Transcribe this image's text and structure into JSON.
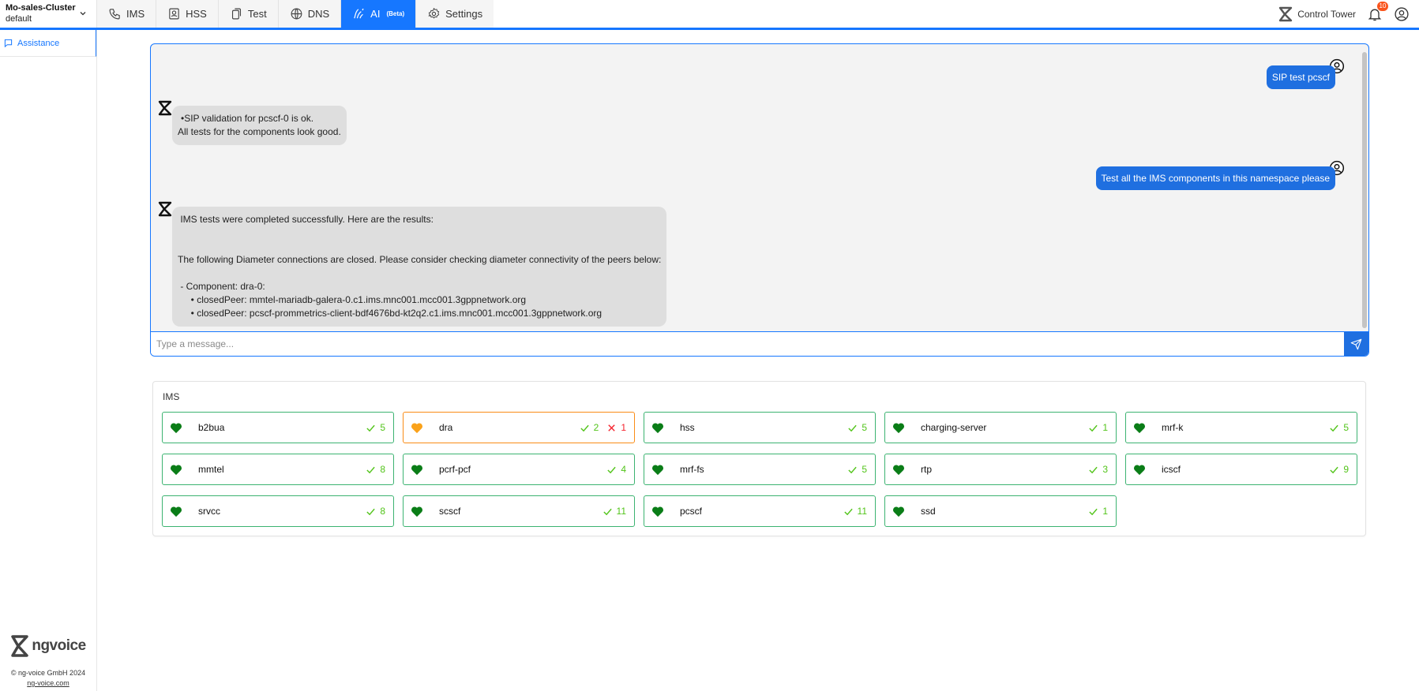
{
  "cluster": {
    "name": "Mo-sales-Cluster",
    "namespace": "default"
  },
  "tabs": [
    {
      "label": "IMS",
      "icon": "phone-icon"
    },
    {
      "label": "HSS",
      "icon": "contact-icon"
    },
    {
      "label": "Test",
      "icon": "test-icon"
    },
    {
      "label": "DNS",
      "icon": "globe-icon"
    },
    {
      "label": "AI",
      "badge": "(Beta)",
      "icon": "ai-icon"
    },
    {
      "label": "Settings",
      "icon": "gear-icon"
    }
  ],
  "header": {
    "control_tower": "Control Tower",
    "notifications": "10"
  },
  "sidebar": {
    "items": [
      {
        "label": "Assistance"
      }
    ]
  },
  "footer": {
    "copyright": "© ng-voice GmbH 2024",
    "site": "ng-voice.com",
    "logo_text": "ngvoice"
  },
  "chat": {
    "messages": [
      {
        "role": "user",
        "text": "SIP test pcscf"
      },
      {
        "role": "bot",
        "lines": [
          "•SIP validation for pcscf-0 is ok.",
          "All tests for the components look good."
        ]
      },
      {
        "role": "user",
        "text": "Test all the IMS components in this namespace please"
      },
      {
        "role": "bot",
        "lines": [
          " IMS tests were completed successfully. Here are the results:",
          "",
          "",
          "The following Diameter connections are closed. Please consider checking diameter connectivity of the peers below:",
          "",
          " - Component: dra-0:",
          "     • closedPeer: mmtel-mariadb-galera-0.c1.ims.mnc001.mcc001.3gppnetwork.org",
          "     • closedPeer: pcscf-prommetrics-client-bdf4676bd-kt2q2.c1.ims.mnc001.mcc001.3gppnetwork.org"
        ]
      }
    ],
    "input_placeholder": "Type a message..."
  },
  "ims": {
    "title": "IMS",
    "components": [
      {
        "name": "b2bua",
        "ok": "5",
        "status": "healthy"
      },
      {
        "name": "dra",
        "ok": "2",
        "fail": "1",
        "status": "warning"
      },
      {
        "name": "hss",
        "ok": "5",
        "status": "healthy"
      },
      {
        "name": "charging-server",
        "ok": "1",
        "status": "healthy"
      },
      {
        "name": "mrf-k",
        "ok": "5",
        "status": "healthy"
      },
      {
        "name": "mmtel",
        "ok": "8",
        "status": "healthy"
      },
      {
        "name": "pcrf-pcf",
        "ok": "4",
        "status": "healthy"
      },
      {
        "name": "mrf-fs",
        "ok": "5",
        "status": "healthy"
      },
      {
        "name": "rtp",
        "ok": "3",
        "status": "healthy"
      },
      {
        "name": "icscf",
        "ok": "9",
        "status": "healthy"
      },
      {
        "name": "srvcc",
        "ok": "8",
        "status": "healthy"
      },
      {
        "name": "scscf",
        "ok": "11",
        "status": "healthy"
      },
      {
        "name": "pcscf",
        "ok": "11",
        "status": "healthy"
      },
      {
        "name": "ssd",
        "ok": "1",
        "status": "healthy"
      }
    ]
  },
  "colors": {
    "accent": "#1677ff",
    "healthy": "#0a7d17",
    "warning": "#faa21a",
    "ok": "#52c41a",
    "fail": "#f5222d"
  }
}
